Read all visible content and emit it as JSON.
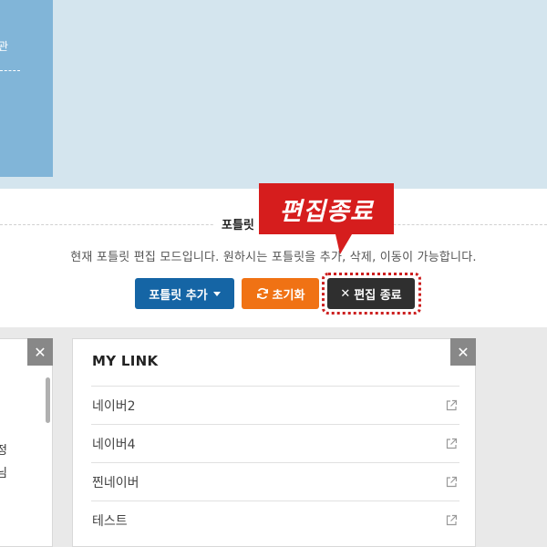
{
  "top_panel": {
    "cut_text": "관"
  },
  "edit_bar": {
    "title": "포틀릿",
    "description": "현재 포틀릿 편집 모드입니다. 원하시는 포틀릿을 추가, 삭제, 이동이 가능합니다.",
    "add_button": "포틀릿 추가",
    "reset_button": "초기화",
    "done_button": "편집 종료"
  },
  "callout": {
    "text": "편집종료"
  },
  "left_card": {
    "fragment_1": "정",
    "fragment_2": "님"
  },
  "link_card": {
    "title": "MY LINK",
    "items": [
      {
        "label": "네이버2",
        "icon": "external-link-icon"
      },
      {
        "label": "네이버4",
        "icon": "external-link-icon"
      },
      {
        "label": "찐네이버",
        "icon": "external-link-icon"
      },
      {
        "label": "테스트",
        "icon": "external-link-icon"
      }
    ]
  },
  "close_symbol": "✕",
  "colors": {
    "add_button": "#1565a5",
    "reset_button": "#f07214",
    "done_button": "#2f2f2f",
    "callout": "#d61d1d",
    "highlight_ring": "#cc1f1f"
  }
}
